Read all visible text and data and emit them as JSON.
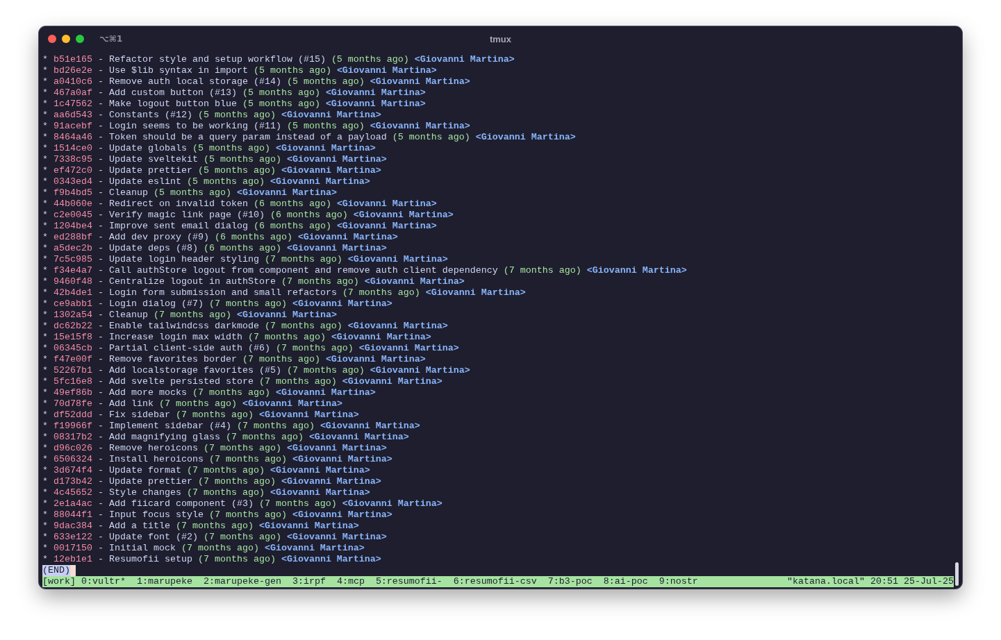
{
  "window": {
    "title": "tmux",
    "shortcut": "⌥⌘1"
  },
  "commits": [
    {
      "graph": "*",
      "hash": "b51e165",
      "sep": "-",
      "message": "Refactor style and setup workflow (#15)",
      "age": "(5 months ago)",
      "author": "<Giovanni Martina>"
    },
    {
      "graph": "*",
      "hash": "bd26e2e",
      "sep": "-",
      "message": "Use $lib syntax in import",
      "age": "(5 months ago)",
      "author": "<Giovanni Martina>"
    },
    {
      "graph": "*",
      "hash": "a0410c6",
      "sep": "-",
      "message": "Remove auth local storage (#14)",
      "age": "(5 months ago)",
      "author": "<Giovanni Martina>"
    },
    {
      "graph": "*",
      "hash": "467a0af",
      "sep": "-",
      "message": "Add custom button (#13)",
      "age": "(5 months ago)",
      "author": "<Giovanni Martina>"
    },
    {
      "graph": "*",
      "hash": "1c47562",
      "sep": "-",
      "message": "Make logout button blue",
      "age": "(5 months ago)",
      "author": "<Giovanni Martina>"
    },
    {
      "graph": "*",
      "hash": "aa6d543",
      "sep": "-",
      "message": "Constants (#12)",
      "age": "(5 months ago)",
      "author": "<Giovanni Martina>"
    },
    {
      "graph": "*",
      "hash": "91acebf",
      "sep": "-",
      "message": "Login seems to be working (#11)",
      "age": "(5 months ago)",
      "author": "<Giovanni Martina>"
    },
    {
      "graph": "*",
      "hash": "8464a46",
      "sep": "-",
      "message": "Token should be a query param instead of a payload",
      "age": "(5 months ago)",
      "author": "<Giovanni Martina>"
    },
    {
      "graph": "*",
      "hash": "1514ce0",
      "sep": "-",
      "message": "Update globals",
      "age": "(5 months ago)",
      "author": "<Giovanni Martina>"
    },
    {
      "graph": "*",
      "hash": "7338c95",
      "sep": "-",
      "message": "Update sveltekit",
      "age": "(5 months ago)",
      "author": "<Giovanni Martina>"
    },
    {
      "graph": "*",
      "hash": "ef472c0",
      "sep": "-",
      "message": "Update prettier",
      "age": "(5 months ago)",
      "author": "<Giovanni Martina>"
    },
    {
      "graph": "*",
      "hash": "0343ed4",
      "sep": "-",
      "message": "Update eslint",
      "age": "(5 months ago)",
      "author": "<Giovanni Martina>"
    },
    {
      "graph": "*",
      "hash": "f9b4bd5",
      "sep": "-",
      "message": "Cleanup",
      "age": "(5 months ago)",
      "author": "<Giovanni Martina>"
    },
    {
      "graph": "*",
      "hash": "44b060e",
      "sep": "-",
      "message": "Redirect on invalid token",
      "age": "(6 months ago)",
      "author": "<Giovanni Martina>"
    },
    {
      "graph": "*",
      "hash": "c2e0045",
      "sep": "-",
      "message": "Verify magic link page (#10)",
      "age": "(6 months ago)",
      "author": "<Giovanni Martina>"
    },
    {
      "graph": "*",
      "hash": "1204be4",
      "sep": "-",
      "message": "Improve sent email dialog",
      "age": "(6 months ago)",
      "author": "<Giovanni Martina>"
    },
    {
      "graph": "*",
      "hash": "ed288bf",
      "sep": "-",
      "message": "Add dev proxy (#9)",
      "age": "(6 months ago)",
      "author": "<Giovanni Martina>"
    },
    {
      "graph": "*",
      "hash": "a5dec2b",
      "sep": "-",
      "message": "Update deps (#8)",
      "age": "(6 months ago)",
      "author": "<Giovanni Martina>"
    },
    {
      "graph": "*",
      "hash": "7c5c985",
      "sep": "-",
      "message": "Update login header styling",
      "age": "(7 months ago)",
      "author": "<Giovanni Martina>"
    },
    {
      "graph": "*",
      "hash": "f34e4a7",
      "sep": "-",
      "message": "Call authStore logout from component and remove auth client dependency",
      "age": "(7 months ago)",
      "author": "<Giovanni Martina>"
    },
    {
      "graph": "*",
      "hash": "9460f48",
      "sep": "-",
      "message": "Centralize logout in authStore",
      "age": "(7 months ago)",
      "author": "<Giovanni Martina>"
    },
    {
      "graph": "*",
      "hash": "42b4de1",
      "sep": "-",
      "message": "Login form submission and small refactors",
      "age": "(7 months ago)",
      "author": "<Giovanni Martina>"
    },
    {
      "graph": "*",
      "hash": "ce9abb1",
      "sep": "-",
      "message": "Login dialog (#7)",
      "age": "(7 months ago)",
      "author": "<Giovanni Martina>"
    },
    {
      "graph": "*",
      "hash": "1302a54",
      "sep": "-",
      "message": "Cleanup",
      "age": "(7 months ago)",
      "author": "<Giovanni Martina>"
    },
    {
      "graph": "*",
      "hash": "dc62b22",
      "sep": "-",
      "message": "Enable tailwindcss darkmode",
      "age": "(7 months ago)",
      "author": "<Giovanni Martina>"
    },
    {
      "graph": "*",
      "hash": "15e15f8",
      "sep": "-",
      "message": "Increase login max width",
      "age": "(7 months ago)",
      "author": "<Giovanni Martina>"
    },
    {
      "graph": "*",
      "hash": "06345cb",
      "sep": "-",
      "message": "Partial client-side auth (#6)",
      "age": "(7 months ago)",
      "author": "<Giovanni Martina>"
    },
    {
      "graph": "*",
      "hash": "f47e00f",
      "sep": "-",
      "message": "Remove favorites border",
      "age": "(7 months ago)",
      "author": "<Giovanni Martina>"
    },
    {
      "graph": "*",
      "hash": "52267b1",
      "sep": "-",
      "message": "Add localstorage favorites (#5)",
      "age": "(7 months ago)",
      "author": "<Giovanni Martina>"
    },
    {
      "graph": "*",
      "hash": "5fc16e8",
      "sep": "-",
      "message": "Add svelte persisted store",
      "age": "(7 months ago)",
      "author": "<Giovanni Martina>"
    },
    {
      "graph": "*",
      "hash": "49ef86b",
      "sep": "-",
      "message": "Add more mocks",
      "age": "(7 months ago)",
      "author": "<Giovanni Martina>"
    },
    {
      "graph": "*",
      "hash": "70d78fe",
      "sep": "-",
      "message": "Add link",
      "age": "(7 months ago)",
      "author": "<Giovanni Martina>"
    },
    {
      "graph": "*",
      "hash": "df52ddd",
      "sep": "-",
      "message": "Fix sidebar",
      "age": "(7 months ago)",
      "author": "<Giovanni Martina>"
    },
    {
      "graph": "*",
      "hash": "f19966f",
      "sep": "-",
      "message": "Implement sidebar (#4)",
      "age": "(7 months ago)",
      "author": "<Giovanni Martina>"
    },
    {
      "graph": "*",
      "hash": "08317b2",
      "sep": "-",
      "message": "Add magnifying glass",
      "age": "(7 months ago)",
      "author": "<Giovanni Martina>"
    },
    {
      "graph": "*",
      "hash": "d96c026",
      "sep": "-",
      "message": "Remove heroicons",
      "age": "(7 months ago)",
      "author": "<Giovanni Martina>"
    },
    {
      "graph": "*",
      "hash": "6506324",
      "sep": "-",
      "message": "Install heroicons",
      "age": "(7 months ago)",
      "author": "<Giovanni Martina>"
    },
    {
      "graph": "*",
      "hash": "3d674f4",
      "sep": "-",
      "message": "Update format",
      "age": "(7 months ago)",
      "author": "<Giovanni Martina>"
    },
    {
      "graph": "*",
      "hash": "d173b42",
      "sep": "-",
      "message": "Update prettier",
      "age": "(7 months ago)",
      "author": "<Giovanni Martina>"
    },
    {
      "graph": "*",
      "hash": "4c45652",
      "sep": "-",
      "message": "Style changes",
      "age": "(7 months ago)",
      "author": "<Giovanni Martina>"
    },
    {
      "graph": "*",
      "hash": "2e1a4ac",
      "sep": "-",
      "message": "Add fiicard component (#3)",
      "age": "(7 months ago)",
      "author": "<Giovanni Martina>"
    },
    {
      "graph": "*",
      "hash": "88044f1",
      "sep": "-",
      "message": "Input focus style",
      "age": "(7 months ago)",
      "author": "<Giovanni Martina>"
    },
    {
      "graph": "*",
      "hash": "9dac384",
      "sep": "-",
      "message": "Add a title",
      "age": "(7 months ago)",
      "author": "<Giovanni Martina>"
    },
    {
      "graph": "*",
      "hash": "633e122",
      "sep": "-",
      "message": "Update font (#2)",
      "age": "(7 months ago)",
      "author": "<Giovanni Martina>"
    },
    {
      "graph": "*",
      "hash": "0017150",
      "sep": "-",
      "message": "Initial mock",
      "age": "(7 months ago)",
      "author": "<Giovanni Martina>"
    },
    {
      "graph": "*",
      "hash": "12eb1e1",
      "sep": "-",
      "message": "Resumofii setup",
      "age": "(7 months ago)",
      "author": "<Giovanni Martina>"
    }
  ],
  "pager_prompt": "(END)",
  "status_bar": {
    "session": "[work]",
    "windows": [
      {
        "label": "0:vultr*"
      },
      {
        "label": "1:marupeke"
      },
      {
        "label": "2:marupeke-gen"
      },
      {
        "label": "3:irpf"
      },
      {
        "label": "4:mcp"
      },
      {
        "label": "5:resumofii-"
      },
      {
        "label": "6:resumofii-csv"
      },
      {
        "label": "7:b3-poc"
      },
      {
        "label": "8:ai-poc"
      },
      {
        "label": "9:nostr"
      }
    ],
    "right": "\"katana.local\" 20:51 25-Jul-25"
  }
}
